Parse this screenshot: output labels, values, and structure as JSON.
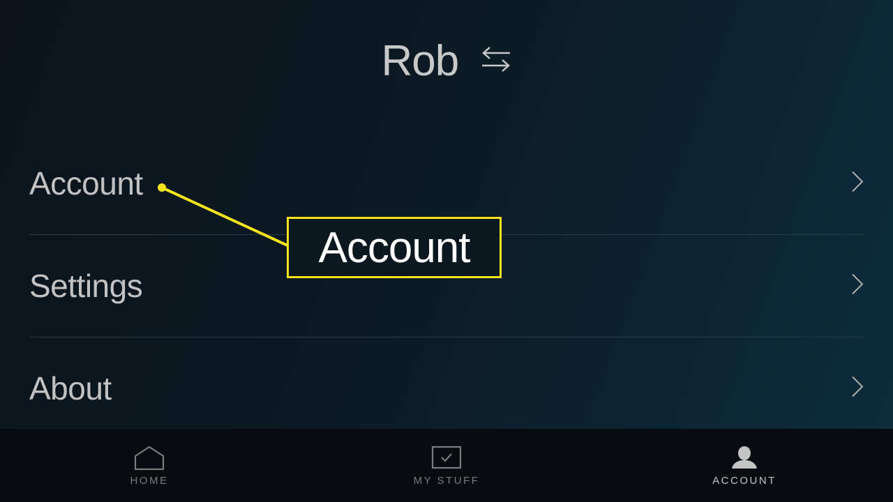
{
  "header": {
    "profile_name": "Rob",
    "switch_icon": "swap-arrows-icon"
  },
  "menu": {
    "items": [
      {
        "label": "Account",
        "icon": "chevron-right-icon"
      },
      {
        "label": "Settings",
        "icon": "chevron-right-icon"
      },
      {
        "label": "About",
        "icon": "chevron-right-icon"
      }
    ]
  },
  "callout": {
    "label": "Account",
    "color": "#f5e41c"
  },
  "tabbar": {
    "tabs": [
      {
        "label": "HOME",
        "icon": "home-icon",
        "active": false
      },
      {
        "label": "MY STUFF",
        "icon": "checkbox-icon",
        "active": false
      },
      {
        "label": "ACCOUNT",
        "icon": "person-icon",
        "active": true
      }
    ]
  }
}
